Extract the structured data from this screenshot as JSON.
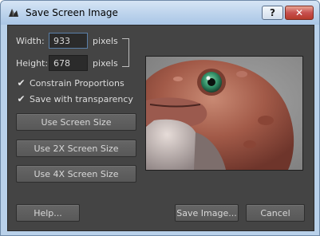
{
  "window": {
    "title": "Save Screen Image",
    "help_glyph": "?",
    "close_glyph": "✕"
  },
  "size": {
    "width_label": "Width:",
    "width_value": "933",
    "height_label": "Height:",
    "height_value": "678",
    "units": "pixels"
  },
  "options": {
    "constrain_label": "Constrain Proportions",
    "constrain_checked": true,
    "transparency_label": "Save with transparency",
    "transparency_checked": true,
    "check_glyph": "✔"
  },
  "size_buttons": {
    "screen": "Use Screen Size",
    "x2": "Use 2X Screen Size",
    "x4": "Use 4X Screen Size"
  },
  "footer": {
    "help": "Help...",
    "save": "Save Image...",
    "cancel": "Cancel"
  },
  "colors": {
    "client_bg": "#444444",
    "button_bg": "#5f5f5f",
    "titlebar": "#bcd3ec",
    "close_red": "#c75050"
  }
}
